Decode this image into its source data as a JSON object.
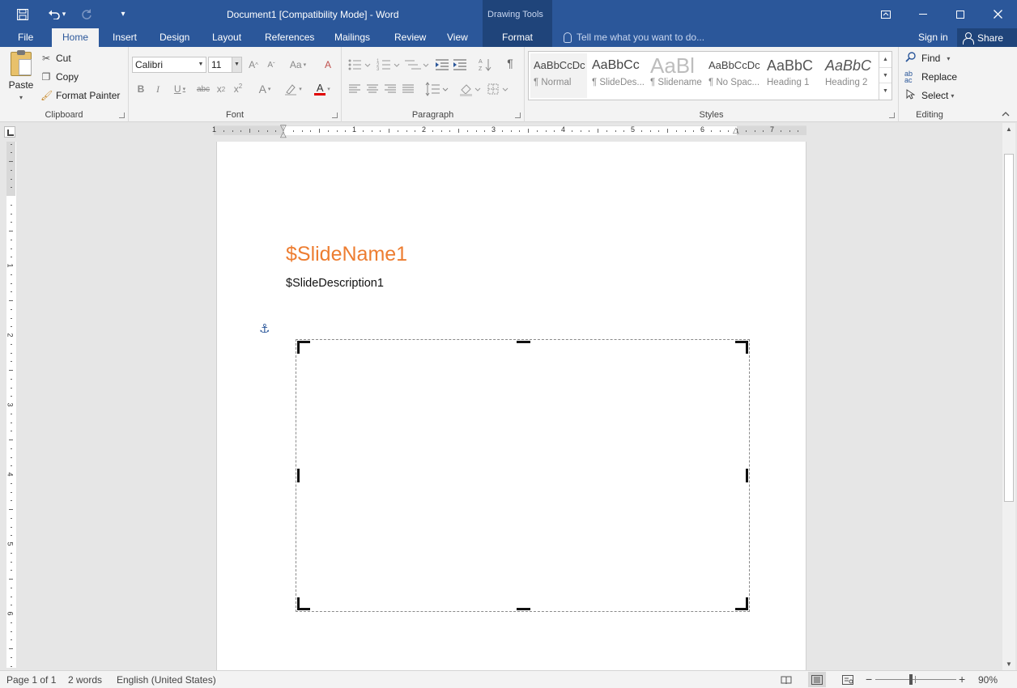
{
  "title_bar": {
    "document_title": "Document1 [Compatibility Mode] - Word",
    "context_group": "Drawing Tools",
    "qat_icons": [
      "save-icon",
      "undo-icon",
      "redo-icon",
      "customize-qat-icon"
    ],
    "window_icons": [
      "ribbon-display-icon",
      "minimize-icon",
      "maximize-icon",
      "close-icon"
    ]
  },
  "tabs": [
    "File",
    "Home",
    "Insert",
    "Design",
    "Layout",
    "References",
    "Mailings",
    "Review",
    "View",
    "Format"
  ],
  "active_tab": "Home",
  "tell_me_placeholder": "Tell me what you want to do...",
  "sign_in": "Sign in",
  "share": "Share",
  "ribbon": {
    "clipboard": {
      "label": "Clipboard",
      "paste": "Paste",
      "cut": "Cut",
      "copy": "Copy",
      "format_painter": "Format Painter"
    },
    "font": {
      "label": "Font",
      "font_name": "Calibri",
      "font_size": "11"
    },
    "paragraph": {
      "label": "Paragraph"
    },
    "styles": {
      "label": "Styles",
      "items": [
        {
          "preview": "AaBbCcDc",
          "name": "¶ Normal"
        },
        {
          "preview": "AaBbCc",
          "name": "¶ SlideDes..."
        },
        {
          "preview": "AaBl",
          "name": "¶ Slidename"
        },
        {
          "preview": "AaBbCcDc",
          "name": "¶ No Spac..."
        },
        {
          "preview": "AaBbC",
          "name": "Heading 1"
        },
        {
          "preview": "AaBbC",
          "name": "Heading 2"
        }
      ]
    },
    "editing": {
      "label": "Editing",
      "find": "Find",
      "replace": "Replace",
      "select": "Select"
    }
  },
  "ruler": {
    "h_numbers": [
      "1",
      "1",
      "2",
      "3",
      "4",
      "5",
      "6",
      "7"
    ],
    "v_numbers": [
      "1",
      "2",
      "3",
      "4",
      "5",
      "6"
    ]
  },
  "document": {
    "slide_name": "$SlideName1",
    "slide_description": "$SlideDescription1"
  },
  "status": {
    "page": "Page 1 of 1",
    "words": "2 words",
    "language": "English (United States)",
    "zoom": "90%",
    "zoom_level_percent": 90
  }
}
